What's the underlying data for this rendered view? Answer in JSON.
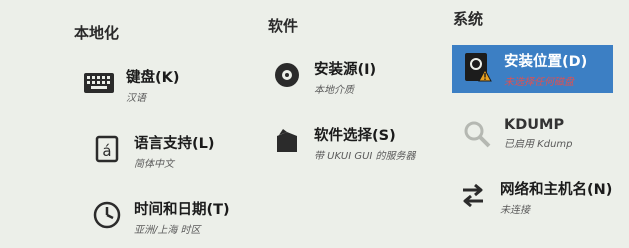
{
  "headings": {
    "localization": "本地化",
    "software": "软件",
    "system": "系统"
  },
  "spokes": {
    "keyboard": {
      "title": "键盘(K)",
      "status": "汉语",
      "icon": "keyboard-icon"
    },
    "language": {
      "title": "语言支持(L)",
      "status": "简体中文",
      "icon": "language-icon"
    },
    "datetime": {
      "title": "时间和日期(T)",
      "status": "亚洲/上海 时区",
      "icon": "clock-icon"
    },
    "source": {
      "title": "安装源(I)",
      "status": "本地介质",
      "icon": "disc-icon"
    },
    "software_selection": {
      "title": "软件选择(S)",
      "status": "带 UKUI GUI 的服务器",
      "icon": "package-icon"
    },
    "destination": {
      "title": "安装位置(D)",
      "status": "未选择任何磁盘",
      "icon": "harddisk-warning-icon",
      "selected": true
    },
    "kdump": {
      "title": "KDUMP",
      "status": "已启用 Kdump",
      "icon": "search-icon"
    },
    "network": {
      "title": "网络和主机名(N)",
      "status": "未连接",
      "icon": "network-arrows-icon"
    }
  },
  "colors": {
    "background": "#ecefe9",
    "selected": "#3c7fc4",
    "warning": "#e05050"
  }
}
